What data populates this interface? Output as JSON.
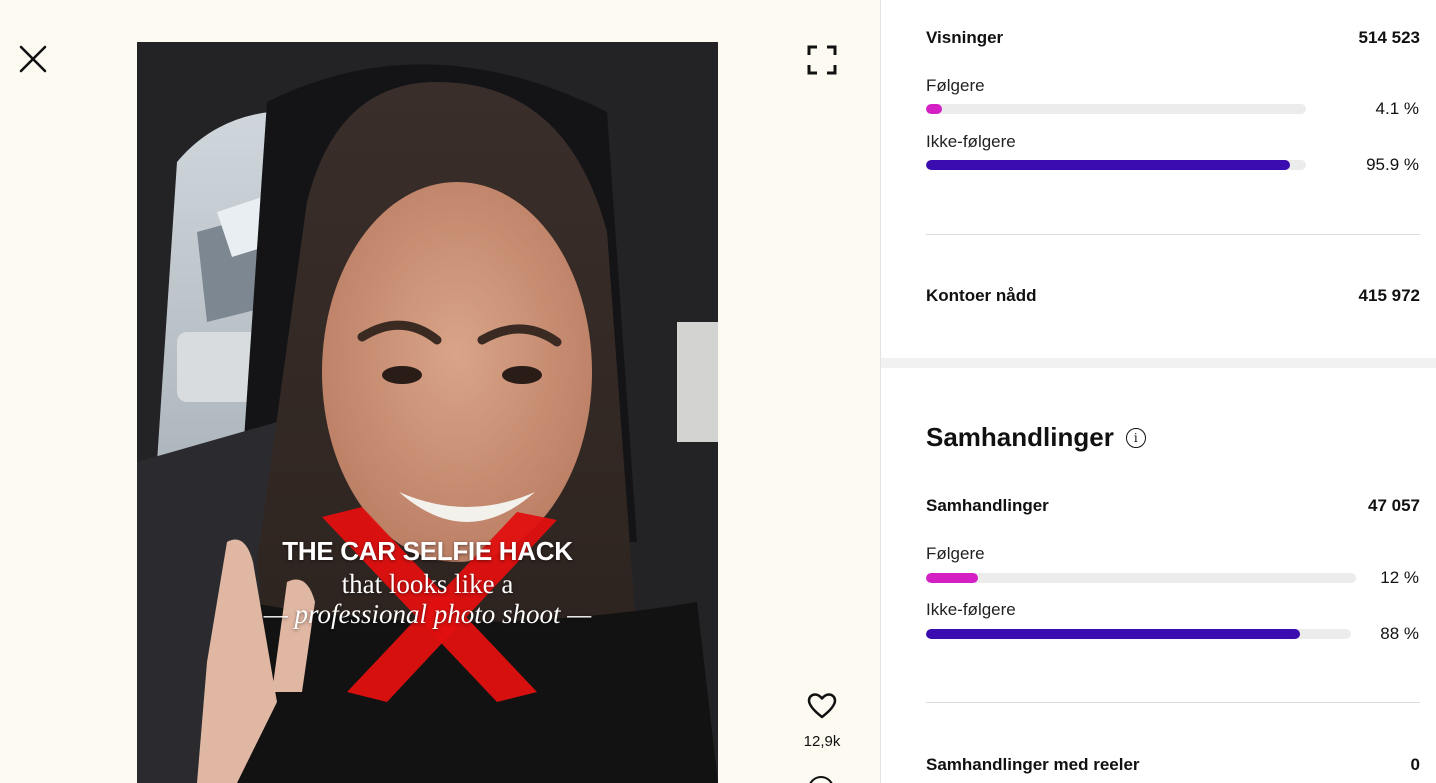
{
  "colors": {
    "followers": "#d41fc4",
    "non_followers": "#3b0cb0",
    "track": "#ececec"
  },
  "media": {
    "overlay_title": "THE CAR SELFIE HACK",
    "overlay_line2": "that looks like a",
    "overlay_line3": "— professional photo shoot —",
    "like_count": "12,9k",
    "icons": {
      "close": "close-icon",
      "expand": "expand-icon",
      "like": "heart-icon",
      "comment": "comment-icon"
    }
  },
  "insights": {
    "views": {
      "label": "Visninger",
      "value": "514 523",
      "followers_label": "Følgere",
      "followers_pct_text": "4.1 %",
      "followers_pct": 4.1,
      "non_followers_label": "Ikke-følgere",
      "non_followers_pct_text": "95.9 %",
      "non_followers_pct": 95.9
    },
    "reach": {
      "label": "Kontoer nådd",
      "value": "415 972"
    },
    "interactions_section": {
      "title": "Samhandlinger",
      "total_label": "Samhandlinger",
      "total_value": "47 057",
      "followers_label": "Følgere",
      "followers_pct_text": "12 %",
      "followers_pct": 12,
      "non_followers_label": "Ikke-følgere",
      "non_followers_pct_text": "88 %",
      "non_followers_pct": 88,
      "reel_label": "Samhandlinger med reeler",
      "reel_value": "0"
    }
  }
}
